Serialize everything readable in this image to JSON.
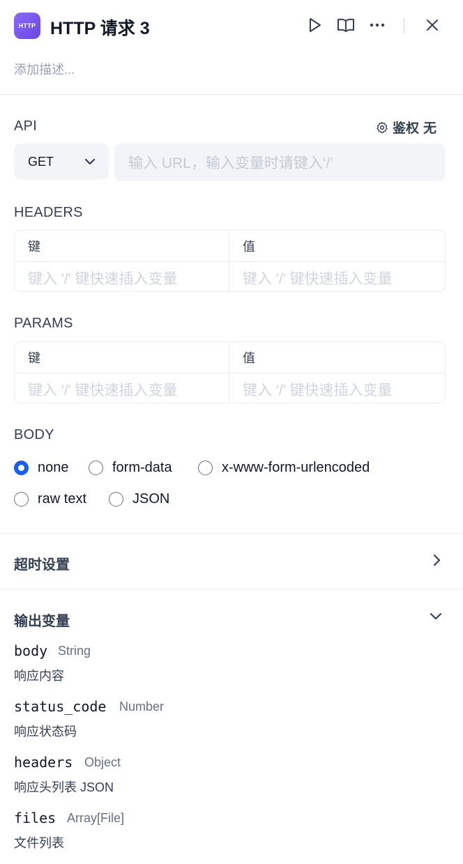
{
  "header": {
    "app_icon_text": "HTTP",
    "title": "HTTP 请求 3",
    "description_placeholder": "添加描述..."
  },
  "api": {
    "label": "API",
    "auth_label": "鉴权",
    "auth_value": "无",
    "method": "GET",
    "url_placeholder": "输入 URL，输入变量时请键入‘/’"
  },
  "headers": {
    "label": "HEADERS",
    "col_key": "键",
    "col_value": "值",
    "key_placeholder": "键入 '/' 键快速插入变量",
    "value_placeholder": "键入 '/' 键快速插入变量"
  },
  "params": {
    "label": "PARAMS",
    "col_key": "键",
    "col_value": "值",
    "key_placeholder": "键入 '/' 键快速插入变量",
    "value_placeholder": "键入 '/' 键快速插入变量"
  },
  "body": {
    "label": "BODY",
    "options": [
      "none",
      "form-data",
      "x-www-form-urlencoded",
      "raw text",
      "JSON"
    ],
    "selected": "none"
  },
  "timeout": {
    "label": "超时设置"
  },
  "outputs": {
    "label": "输出变量",
    "items": [
      {
        "name": "body",
        "type": "String",
        "desc": "响应内容"
      },
      {
        "name": "status_code",
        "type": "Number",
        "desc": "响应状态码"
      },
      {
        "name": "headers",
        "type": "Object",
        "desc": "响应头列表 JSON"
      },
      {
        "name": "files",
        "type": "Array[File]",
        "desc": "文件列表"
      }
    ]
  },
  "colors": {
    "accent": "#155eef",
    "icon_bg": "#7553ee"
  },
  "icons": [
    "play-icon",
    "book-icon",
    "more-icon",
    "close-icon",
    "gear-icon",
    "chevron-down-icon",
    "chevron-right-icon"
  ]
}
